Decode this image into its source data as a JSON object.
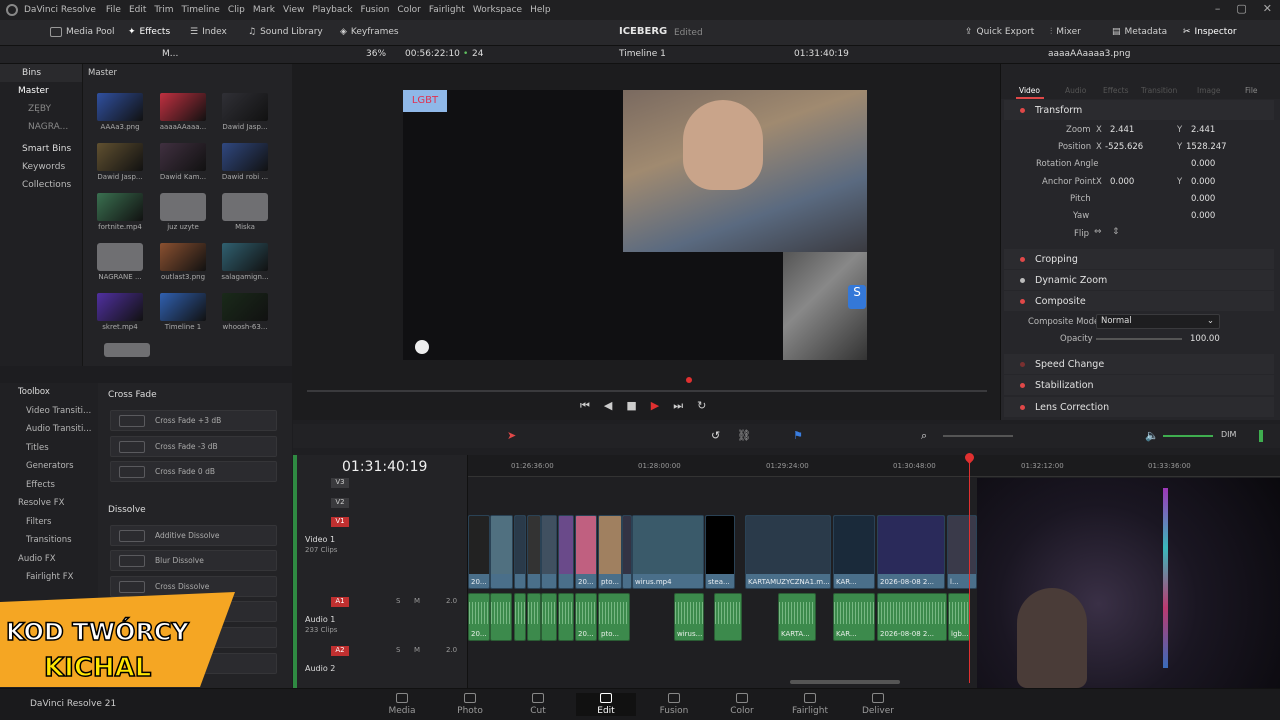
{
  "menubar": {
    "app_name": "DaVinci Resolve",
    "items": [
      "File",
      "Edit",
      "Trim",
      "Timeline",
      "Clip",
      "Mark",
      "View",
      "Playback",
      "Fusion",
      "Color",
      "Fairlight",
      "Workspace",
      "Help"
    ]
  },
  "toolbar": {
    "media_pool": "Media Pool",
    "effects": "Effects",
    "index": "Index",
    "sound_library": "Sound Library",
    "keyframes": "Keyframes",
    "project_name": "ICEBERG",
    "project_status": "Edited",
    "quick_export": "Quick Export",
    "mixer": "Mixer",
    "metadata": "Metadata",
    "inspector": "Inspector"
  },
  "subbar": {
    "pool_view": "M...",
    "zoom": "36%",
    "timecode_left": "00:56:22:10",
    "fps": "24",
    "timeline_name": "Timeline 1",
    "timecode_right": "01:31:40:19",
    "inspected_file": "aaaaAAaaaa3.png"
  },
  "bins": {
    "header": "Bins",
    "master_header": "Master",
    "items": [
      "Master",
      "ZĘBY",
      "NAGRA..."
    ],
    "smart_bins": "Smart Bins",
    "smart_items": [
      "Keywords",
      "Collections"
    ]
  },
  "media": [
    {
      "label": "AAAa3.png"
    },
    {
      "label": "aaaaAAaaa..."
    },
    {
      "label": "Dawid Jasp..."
    },
    {
      "label": "Dawid Jasp..."
    },
    {
      "label": "Dawid Kam..."
    },
    {
      "label": "Dawid robi ..."
    },
    {
      "label": "fortnite.mp4"
    },
    {
      "label": "juz uzyte"
    },
    {
      "label": "Miska"
    },
    {
      "label": "NAGRANE ..."
    },
    {
      "label": "outlast3.png"
    },
    {
      "label": "salagamign..."
    },
    {
      "label": "skret.mp4"
    },
    {
      "label": "Timeline 1"
    },
    {
      "label": "whoosh-63..."
    }
  ],
  "viewer": {
    "overlay_tag": "LGBT",
    "timecode": "01:31:40:19"
  },
  "inspector_tabs": [
    "Video",
    "Audio",
    "Effects",
    "Transition",
    "Image",
    "File"
  ],
  "transform": {
    "title": "Transform",
    "zoom_label": "Zoom",
    "zoom_x": "2.441",
    "zoom_y": "2.441",
    "position_label": "Position",
    "position_x": "-525.626",
    "position_y": "1528.247",
    "rotation_label": "Rotation Angle",
    "rotation": "0.000",
    "anchor_label": "Anchor Point",
    "anchor_x": "0.000",
    "anchor_y": "0.000",
    "pitch_label": "Pitch",
    "pitch": "0.000",
    "yaw_label": "Yaw",
    "yaw": "0.000",
    "flip_label": "Flip",
    "x_label": "X",
    "y_label": "Y"
  },
  "sections": {
    "cropping": "Cropping",
    "dynamic_zoom": "Dynamic Zoom",
    "composite": "Composite",
    "composite_mode_label": "Composite Mode",
    "composite_mode": "Normal",
    "opacity_label": "Opacity",
    "opacity": "100.00",
    "speed_change": "Speed Change",
    "stabilization": "Stabilization",
    "lens_correction": "Lens Correction"
  },
  "toolbox": {
    "header": "Toolbox",
    "items": [
      "Video Transiti...",
      "Audio Transiti...",
      "Titles",
      "Generators",
      "Effects",
      "Resolve FX",
      "Filters",
      "Transitions",
      "Audio FX",
      "Fairlight FX"
    ]
  },
  "effects_panel": {
    "cross_fade_header": "Cross Fade",
    "cross_fade_items": [
      "Cross Fade +3 dB",
      "Cross Fade -3 dB",
      "Cross Fade 0 dB"
    ],
    "dissolve_header": "Dissolve",
    "dissolve_items": [
      "Additive Dissolve",
      "Blur Dissolve",
      "Cross Dissolve"
    ]
  },
  "timeline": {
    "timecode": "01:31:40:19",
    "ruler": [
      "01:26:36:00",
      "01:28:00:00",
      "01:29:24:00",
      "01:30:48:00",
      "01:32:12:00",
      "01:33:36:00"
    ],
    "tracks": {
      "v3": "V3",
      "v2": "V2",
      "v1": "V1",
      "video1_name": "Video 1",
      "video1_count": "207 Clips",
      "a1": "A1",
      "audio1_name": "Audio 1",
      "audio1_count": "233 Clips",
      "a2": "A2",
      "audio2_name": "Audio 2",
      "a1_vol": "2.0",
      "a2_vol": "2.0",
      "s": "S",
      "m": "M"
    },
    "video_clips": [
      "20...",
      "20...",
      "pto...",
      "wirus.mp4",
      "stea...",
      "KARTAMUZYCZNA1.m...",
      "KAR...",
      "2026-08-08 2...",
      "l..."
    ],
    "audio_clips": [
      "20...",
      "20...",
      "pto...",
      "wirus...",
      "KARTA...",
      "KAR...",
      "2026-08-08 2...",
      "lgb..."
    ],
    "dim": "DIM"
  },
  "bottomnav": {
    "items": [
      "Media",
      "Photo",
      "Cut",
      "Edit",
      "Fusion",
      "Color",
      "Fairlight",
      "Deliver"
    ],
    "active": "Edit",
    "version": "DaVinci Resolve 21"
  },
  "promo": {
    "line1": "KOD TWÓRCY",
    "line2": "KICHAL"
  },
  "colors": {
    "accent_red": "#e04848",
    "clip_blue": "#4a6f8a",
    "clip_green": "#3c8a4c",
    "playhead": "#e03030",
    "promo_orange": "#f5a623"
  }
}
